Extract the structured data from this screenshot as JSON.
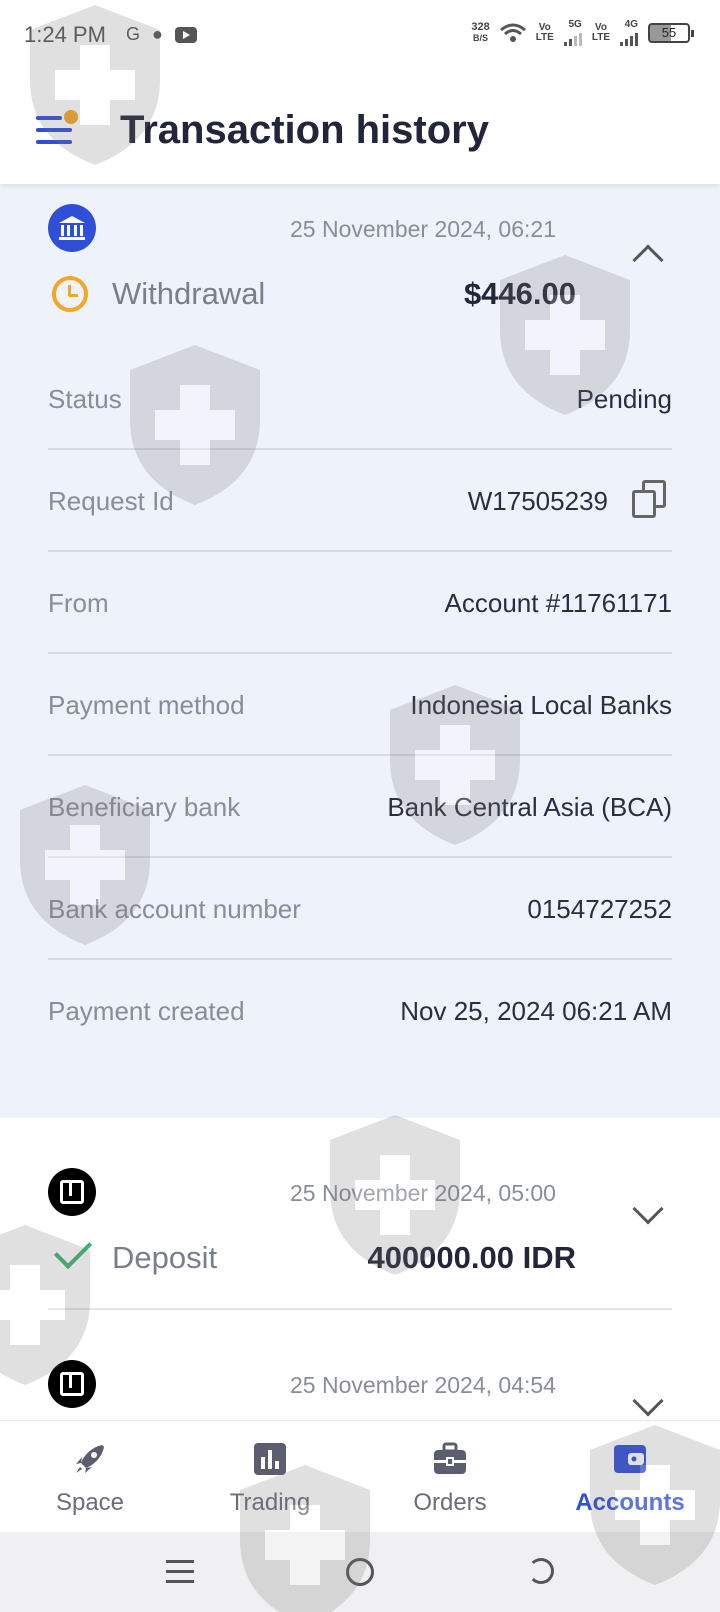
{
  "status_bar": {
    "time": "1:24 PM",
    "net_speed": "328",
    "net_unit": "B/S",
    "sim1": "Vo\nLTE",
    "sim1_net": "5G",
    "sim2": "Vo\nLTE",
    "sim2_net": "4G",
    "battery": "55"
  },
  "header": {
    "title": "Transaction history"
  },
  "expanded_transaction": {
    "date": "25 November 2024, 06:21",
    "type": "Withdrawal",
    "amount": "$446.00",
    "details": [
      {
        "label": "Status",
        "value": "Pending"
      },
      {
        "label": "Request Id",
        "value": "W17505239"
      },
      {
        "label": "From",
        "value": "Account #11761171"
      },
      {
        "label": "Payment method",
        "value": "Indonesia Local Banks"
      },
      {
        "label": "Beneficiary bank",
        "value": "Bank Central Asia (BCA)"
      },
      {
        "label": "Bank account number",
        "value": "0154727252"
      },
      {
        "label": "Payment created",
        "value": "Nov 25, 2024 06:21 AM"
      }
    ]
  },
  "transactions": [
    {
      "date": "25 November 2024, 05:00",
      "type": "Deposit",
      "amount": "400000.00 IDR"
    },
    {
      "date": "25 November 2024, 04:54"
    }
  ],
  "bottom_nav": {
    "items": [
      {
        "label": "Space",
        "icon": "rocket-icon"
      },
      {
        "label": "Trading",
        "icon": "chart-icon"
      },
      {
        "label": "Orders",
        "icon": "briefcase-icon"
      },
      {
        "label": "Accounts",
        "icon": "wallet-icon",
        "active": true
      }
    ]
  },
  "colors": {
    "accent": "#2f4fd6",
    "pending": "#f5a623",
    "success": "#3cb371",
    "expanded_bg": "#eef2fb"
  }
}
